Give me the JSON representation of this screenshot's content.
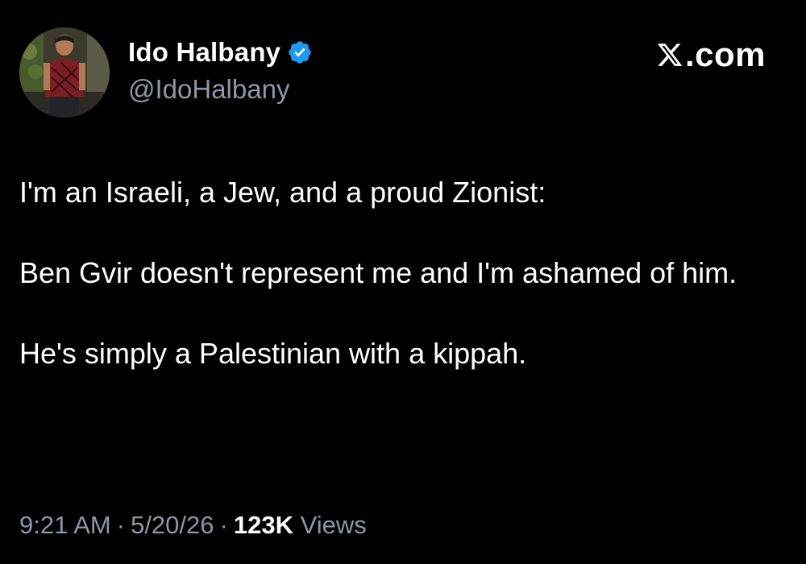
{
  "author": {
    "display_name": "Ido Halbany",
    "handle": "@IdoHalbany",
    "verified_icon": "verified-badge-icon"
  },
  "brand": {
    "label": ".com",
    "icon": "x-logo-icon"
  },
  "tweet": {
    "paragraphs": [
      "I'm an Israeli, a Jew, and a proud Zionist:",
      "Ben Gvir doesn't represent me and I'm ashamed of him.",
      "He's simply a Palestinian with a kippah."
    ]
  },
  "meta": {
    "time": "9:21 AM",
    "separator": "·",
    "date": "5/20/26",
    "views_count": "123K",
    "views_label": "Views"
  },
  "colors": {
    "background": "#000000",
    "text_primary": "#ffffff",
    "text_secondary": "#8b98a5",
    "verified_blue": "#1d9bf0"
  }
}
